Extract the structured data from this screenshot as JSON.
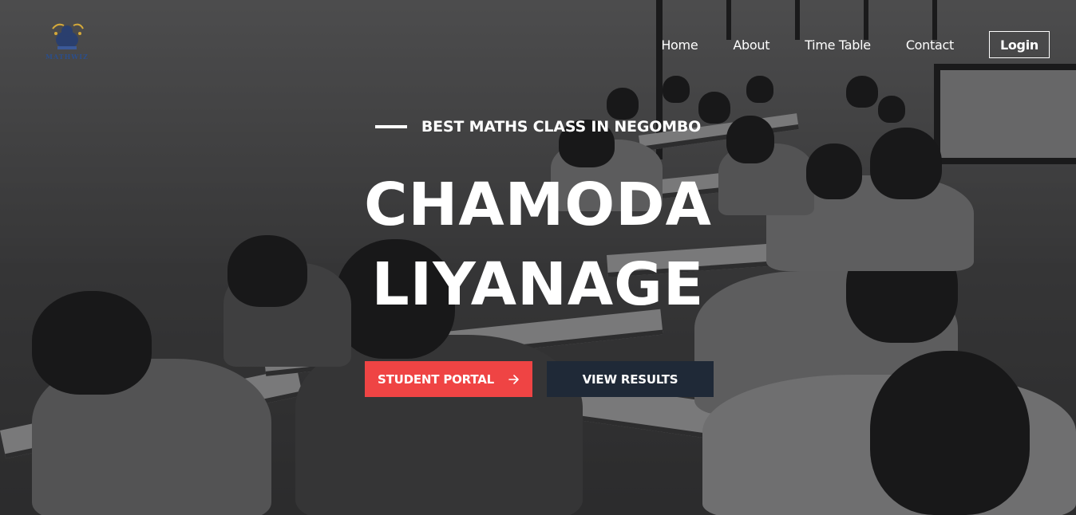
{
  "brand": {
    "logo_text": "MATHWIZ",
    "accent_color": "#ef4444",
    "dark_color": "#1f2937"
  },
  "nav": {
    "items": [
      {
        "label": "Home"
      },
      {
        "label": "About"
      },
      {
        "label": "Time Table"
      },
      {
        "label": "Contact"
      }
    ],
    "login_label": "Login"
  },
  "hero": {
    "tagline": "BEST MATHS CLASS IN NEGOMBO",
    "title_line1": "CHAMODA",
    "title_line2": "LIYANAGE",
    "primary_button": {
      "label": "STUDENT PORTAL",
      "icon": "arrow-right-icon"
    },
    "secondary_button": {
      "label": "VIEW RESULTS"
    },
    "background": "classroom-exam-photo-grayscale"
  }
}
